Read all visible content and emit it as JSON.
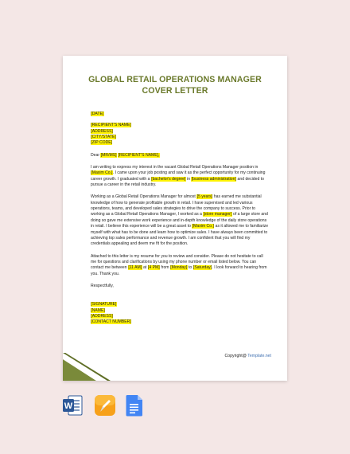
{
  "title": {
    "line1": "GLOBAL RETAIL OPERATIONS MANAGER",
    "line2": "COVER LETTER"
  },
  "header": {
    "date": "[DATE]",
    "recipient_name": "[RECIPIENT'S NAME]",
    "address": "[ADDRESS]",
    "city_state": "[CITY/STATE]",
    "zip": "[ZIP CODE]"
  },
  "greeting": {
    "dear": "Dear",
    "salutation": "[MR/MS]",
    "name": "[RECIPIENT'S NAME],"
  },
  "p1": {
    "t1": "I am writing to express my interest in the vacant Global Retail Operations Manager position in",
    "company": "[Maxim Co.]",
    "t2": ". I came upon your job posting and saw it as the perfect opportunity for my continuing career growth. I graduated with a",
    "degree": "[bachelor's degree]",
    "t3": "in",
    "field": "[business administration]",
    "t4": "and decided to pursue a career in the retail industry."
  },
  "p2": {
    "t1": "Working as a Global Retail Operations Manager for almost",
    "years": "[5 years]",
    "t2": "has earned me substantial knowledge of how to generate profitable growth in retail. I have supervised and led various operations, teams, and developed sales strategies to drive the company to success. Prior to working as a Global Retail Operations Manager, I worked as a",
    "role": "[store manager]",
    "t3": "of a large store and doing so gave me extensive work experience and in-depth knowledge of the daily store operations in retail. I believe this experience will be a great asset to",
    "company": "[Maxim Co.]",
    "t4": "as it allowed me to familiarize myself with what has to be done and learn how to optimize sales. I have always been committed to achieving top sales performance and revenue growth. I am confident that you will find my credentials appealing and deem me fit for the position."
  },
  "p3": {
    "t1": "Attached to this letter is my resume for you to review and consider. Please do not hesitate to call me for questions and clarifications by using my phone number or email listed below. You can contact me between",
    "time_from": "[11 AM]",
    "t2": "at",
    "time_to": "[4 PM]",
    "t3": "from",
    "day_from": "[Monday]",
    "t4": "to",
    "day_to": "[Saturday]",
    "t5": ". I look forward to hearing from you. Thank you."
  },
  "closing": "Respectfully,",
  "signature_block": {
    "signature": "[SIGNATURE]",
    "name": "[NAME]",
    "address": "[ADDRESS]",
    "contact": "[CONTACT NUMBER]"
  },
  "footer": {
    "copyright": "Copyright@",
    "brand": "Template.net"
  },
  "colors": {
    "title": "#6b7a2c",
    "highlight": "#fff200",
    "background": "#f4e7e6",
    "corner": "#6b7a2c"
  },
  "app_icons": [
    "word-icon",
    "pages-icon",
    "google-docs-icon"
  ]
}
